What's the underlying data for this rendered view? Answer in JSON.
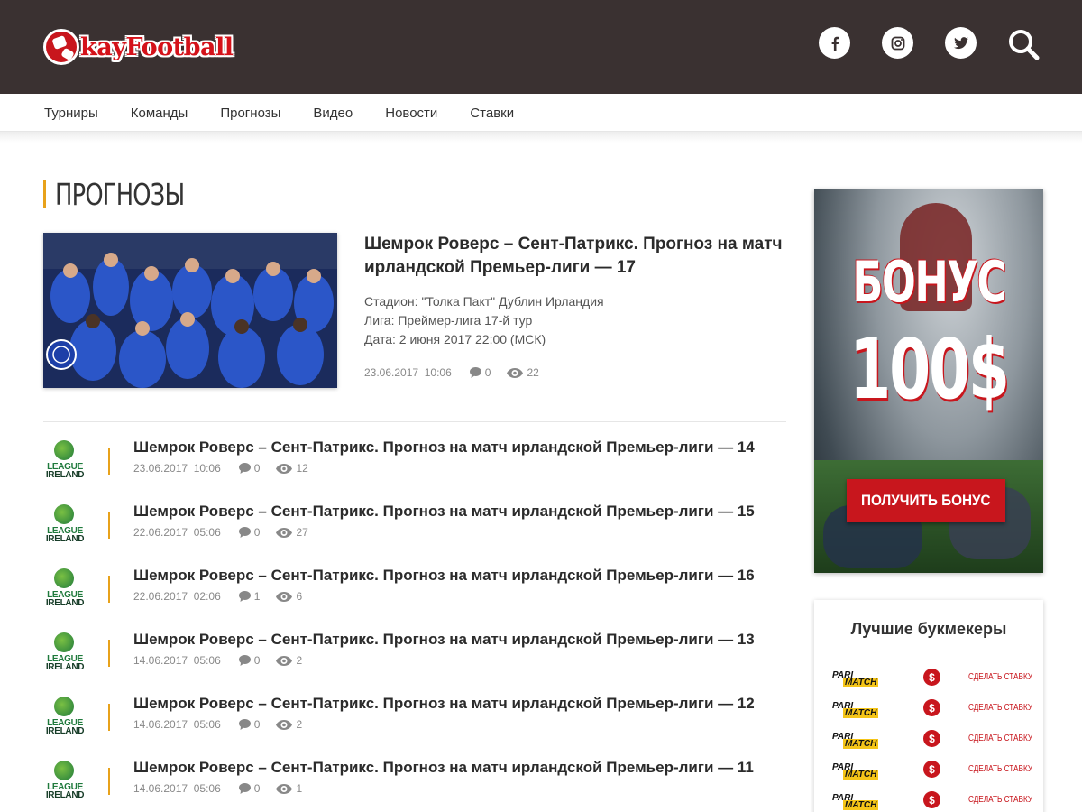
{
  "header": {
    "logo_text": "kayFootball",
    "logo_initial": "O"
  },
  "nav": {
    "items": [
      "Турниры",
      "Команды",
      "Прогнозы",
      "Видео",
      "Новости",
      "Ставки"
    ]
  },
  "section": {
    "title": "ПРОГНОЗЫ"
  },
  "featured": {
    "title": "Шемрок Роверс – Сент-Патрикс. Прогноз на матч ирландской Премьер-лиги — 17",
    "stadium": "Стадион: \"Толка Пакт\" Дублин Ирландия",
    "league": "Лига: Преймер-лига 17-й тур",
    "date_line": "Дата: 2 июня 2017 22:00 (МСК)",
    "date": "23.06.2017",
    "time": "10:06",
    "comments": "0",
    "views": "22"
  },
  "articles": [
    {
      "title": "Шемрок Роверс – Сент-Патрикс. Прогноз на матч ирландской Премьер-лиги — 14",
      "date": "23.06.2017",
      "time": "10:06",
      "comments": "0",
      "views": "12"
    },
    {
      "title": "Шемрок Роверс – Сент-Патрикс. Прогноз на матч ирландской Премьер-лиги — 15",
      "date": "22.06.2017",
      "time": "05:06",
      "comments": "0",
      "views": "27"
    },
    {
      "title": "Шемрок Роверс – Сент-Патрикс. Прогноз на матч ирландской Премьер-лиги — 16",
      "date": "22.06.2017",
      "time": "02:06",
      "comments": "1",
      "views": "6"
    },
    {
      "title": "Шемрок Роверс – Сент-Патрикс. Прогноз на матч ирландской Премьер-лиги — 13",
      "date": "14.06.2017",
      "time": "05:06",
      "comments": "0",
      "views": "2"
    },
    {
      "title": "Шемрок Роверс – Сент-Патрикс. Прогноз на матч ирландской Премьер-лиги — 12",
      "date": "14.06.2017",
      "time": "05:06",
      "comments": "0",
      "views": "2"
    },
    {
      "title": "Шемрок Роверс – Сент-Патрикс. Прогноз на матч ирландской Премьер-лиги — 11",
      "date": "14.06.2017",
      "time": "05:06",
      "comments": "0",
      "views": "1"
    }
  ],
  "league_logo": {
    "line1": "LEAGUE",
    "line2": "IRELAND"
  },
  "banner": {
    "bonus": "БОНУС",
    "amount": "100$",
    "cta": "ПОЛУЧИТЬ БОНУС"
  },
  "bookmakers": {
    "title": "Лучшие букмекеры",
    "logo_pari": "PARI",
    "logo_match": "MATCH",
    "dollar": "$",
    "link": "СДЕЛАТЬ СТАВКУ",
    "count": 5
  },
  "colors": {
    "header_bg": "#3a3131",
    "accent": "#e8a21b",
    "brand_red": "#c8161d",
    "league_green": "#1f7a3c"
  },
  "icons": {
    "facebook": "facebook-icon",
    "instagram": "instagram-icon",
    "twitter": "twitter-icon",
    "search": "search-icon",
    "comment": "comment-icon",
    "views": "eye-icon"
  }
}
